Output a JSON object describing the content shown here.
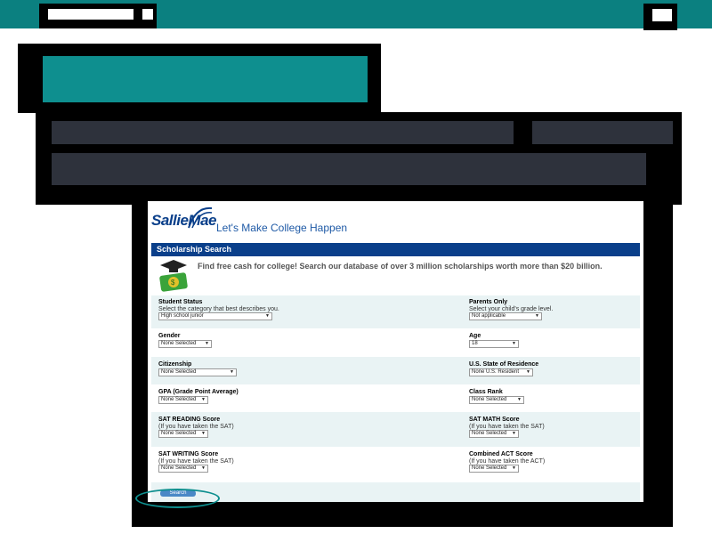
{
  "header": {
    "title": ""
  },
  "logo": {
    "brand": "SallieMae",
    "tagline": "Let's Make College Happen"
  },
  "section_title": "Scholarship Search",
  "intro_text": "Find free cash for college! Search our database of over 3 million scholarships worth more than $20 billion.",
  "fields": {
    "student_status": {
      "label": "Student Status",
      "sub": "Select the category that best describes you.",
      "value": "High school junior"
    },
    "parents_only": {
      "label": "Parents Only",
      "sub": "Select your child's grade level.",
      "value": "Not applicable"
    },
    "gender": {
      "label": "Gender",
      "value": "None Selected"
    },
    "age": {
      "label": "Age",
      "value": "18"
    },
    "citizenship": {
      "label": "Citizenship",
      "value": "None Selected"
    },
    "state": {
      "label": "U.S. State of Residence",
      "value": "None U.S. Resident"
    },
    "gpa": {
      "label": "GPA (Grade Point Average)",
      "value": "None Selected"
    },
    "class_rank": {
      "label": "Class Rank",
      "value": "None Selected"
    },
    "sat_reading": {
      "label": "SAT READING Score",
      "sub": "(If you have taken the SAT)",
      "value": "None Selected"
    },
    "sat_math": {
      "label": "SAT MATH Score",
      "sub": "(If you have taken the SAT)",
      "value": "None Selected"
    },
    "sat_writing": {
      "label": "SAT WRITING Score",
      "sub": "(If you have taken the SAT)",
      "value": "None Selected"
    },
    "act": {
      "label": "Combined ACT Score",
      "sub": "(If you have taken the ACT)",
      "value": "None Selected"
    }
  },
  "search_button": "Search",
  "colors": {
    "teal": "#0b8080",
    "navy": "#0a3f8a",
    "row_alt": "#e9f3f4"
  }
}
